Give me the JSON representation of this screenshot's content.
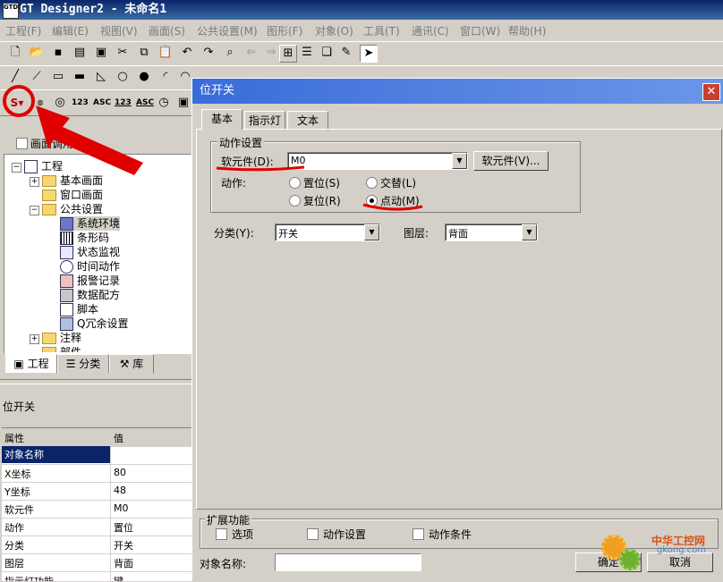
{
  "app": {
    "title": "GT Designer2 - 未命名1",
    "icon_label": "GTD2"
  },
  "menu": [
    "工程(F)",
    "编辑(E)",
    "视图(V)",
    "画面(S)",
    "公共设置(M)",
    "图形(F)",
    "对象(O)",
    "工具(T)",
    "通讯(C)",
    "窗口(W)",
    "帮助(H)"
  ],
  "toolbar3": {
    "switch_label": "S",
    "items": [
      "123",
      "ASC",
      "123",
      "ASC"
    ]
  },
  "left_panel": {
    "screen_call_label": "画面调用",
    "tree": {
      "root": "工程",
      "base_screen": "基本画面",
      "window_screen": "窗口画面",
      "common": "公共设置",
      "common_items": [
        "系统环境",
        "条形码",
        "状态监视",
        "时间动作",
        "报警记录",
        "数据配方",
        "脚本",
        "Q冗余设置"
      ],
      "comment": "注释",
      "cut": "部件"
    },
    "tabs": [
      "工程",
      "分类",
      "库"
    ]
  },
  "properties": {
    "title": "位开关",
    "headers": [
      "属性",
      "值"
    ],
    "rows": [
      {
        "k": "对象名称",
        "v": ""
      },
      {
        "k": "X坐标",
        "v": "80"
      },
      {
        "k": "Y坐标",
        "v": "48"
      },
      {
        "k": "软元件",
        "v": "M0"
      },
      {
        "k": "动作",
        "v": "置位"
      },
      {
        "k": "分类",
        "v": "开关"
      },
      {
        "k": "图层",
        "v": "背面"
      },
      {
        "k": "指示灯功能",
        "v": "键"
      }
    ]
  },
  "dialog": {
    "title": "位开关",
    "tabs": [
      "基本",
      "指示灯",
      "文本"
    ],
    "action_group": "动作设置",
    "device_label": "软元件(D):",
    "device_value": "M0",
    "device_button": "软元件(V)...",
    "action_label": "动作:",
    "actions": [
      "置位(S)",
      "交替(L)",
      "复位(R)",
      "点动(M)"
    ],
    "selected_action": "点动(M)",
    "category_label": "分类(Y):",
    "category_value": "开关",
    "layer_label": "图层:",
    "layer_value": "背面",
    "ext_group": "扩展功能",
    "ext_checks": [
      "选项",
      "动作设置",
      "动作条件"
    ],
    "object_name_label": "对象名称:",
    "object_name_value": "",
    "ok": "确定",
    "cancel": "取消"
  },
  "watermark": {
    "text": "中华工控网",
    "url": "gkong.com"
  },
  "colors": {
    "annotation_red": "#e00000",
    "titlebar": "#0a246a",
    "dialog_titlebar": "#3a6cd9"
  }
}
